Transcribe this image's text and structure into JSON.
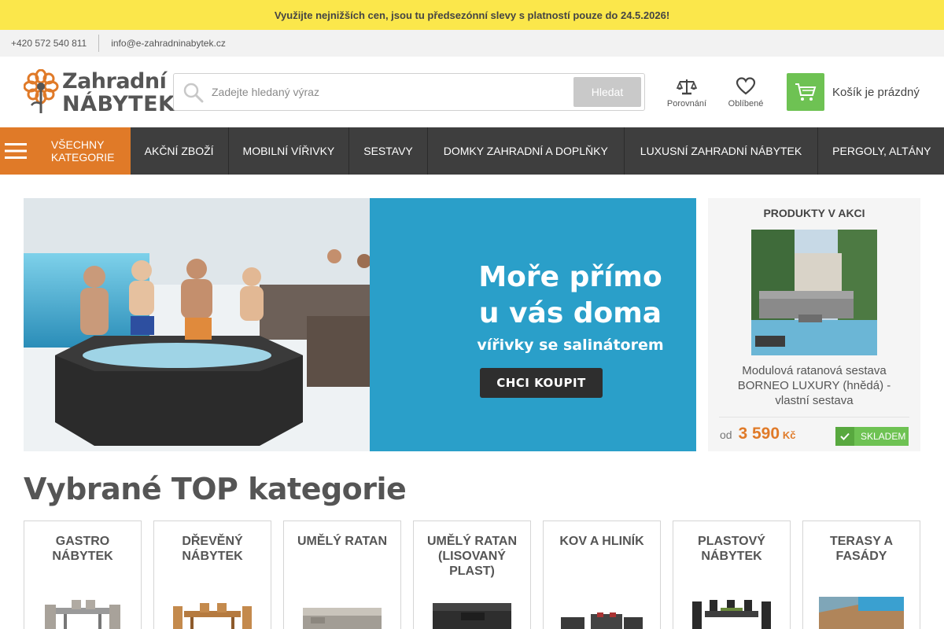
{
  "promo_bar": {
    "text": "Využijte nejnižších cen, jsou tu předsezónní slevy s platností pouze do 24.5.2026!"
  },
  "contact": {
    "phone": "+420 572 540 811",
    "email": "info@e-zahradninabytek.cz"
  },
  "logo": {
    "line1": "Zahradní",
    "line2": "NÁBYTEK"
  },
  "search": {
    "placeholder": "Zadejte hledaný výraz",
    "button": "Hledat"
  },
  "header_icons": {
    "compare": "Porovnání",
    "favorites": "Oblíbené"
  },
  "cart": {
    "text": "Košík je prázdný"
  },
  "nav": {
    "all_categories": "VŠECHNY KATEGORIE",
    "items": [
      {
        "label": "AKČNÍ ZBOŽÍ"
      },
      {
        "label": "MOBILNÍ VÍŘIVKY"
      },
      {
        "label": "SESTAVY"
      },
      {
        "label": "DOMKY ZAHRADNÍ A DOPLŇKY"
      },
      {
        "label": "LUXUSNÍ ZAHRADNÍ NÁBYTEK"
      },
      {
        "label": "PERGOLY, ALTÁNY"
      }
    ]
  },
  "banner": {
    "headline_line1": "Moře přímo",
    "headline_line2": "u vás doma",
    "subline": "vířivky se salinátorem",
    "cta": "CHCI KOUPIT"
  },
  "featured": {
    "title": "PRODUKTY V AKCI",
    "product_name": "Modulová ratanová sestava BORNEO LUXURY (hnědá) - vlastní sestava",
    "price_prefix": "od",
    "price": "3 590",
    "currency": "Kč",
    "stock": "SKLADEM"
  },
  "top_categories": {
    "title": "Vybrané TOP kategorie",
    "items": [
      {
        "name": "GASTRO NÁBYTEK"
      },
      {
        "name": "DŘEVĚNÝ NÁBYTEK"
      },
      {
        "name": "UMĚLÝ RATAN"
      },
      {
        "name": "UMĚLÝ RATAN (LISOVANÝ PLAST)"
      },
      {
        "name": "KOV A HLINÍK"
      },
      {
        "name": "PLASTOVÝ NÁBYTEK"
      },
      {
        "name": "TERASY A FASÁDY"
      }
    ]
  },
  "colors": {
    "accent_orange": "#e07a28",
    "promo_yellow": "#fbe74b",
    "nav_dark": "#3e3e3e",
    "stock_green": "#6ec253"
  },
  "icons": [
    "phone-separator",
    "search-icon",
    "scales-icon",
    "heart-icon",
    "cart-icon",
    "hamburger-icon",
    "check-icon"
  ]
}
